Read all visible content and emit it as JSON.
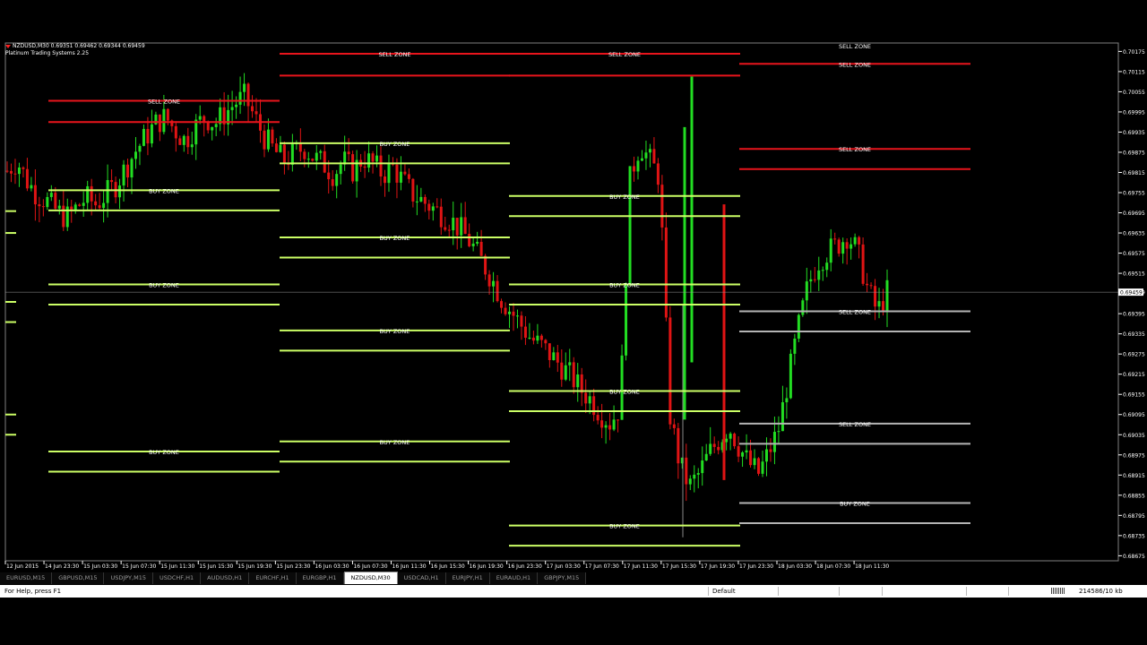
{
  "chart": {
    "symbol_line": "NZDUSD,M30  0.69351 0.69462 0.69344 0.69459",
    "indicator_name": "Platinum Trading Systems 2.25",
    "current_price": "0.69459"
  },
  "chart_data": {
    "type": "candlestick",
    "symbol": "NZDUSD",
    "timeframe": "M30",
    "ohlc": {
      "open": 0.69351,
      "high": 0.69462,
      "low": 0.69344,
      "close": 0.69459
    },
    "y_ticks": [
      "0.70175",
      "0.70115",
      "0.70055",
      "0.69995",
      "0.69935",
      "0.69875",
      "0.69815",
      "0.69755",
      "0.69695",
      "0.69635",
      "0.69575",
      "0.69515",
      "0.69459",
      "0.69395",
      "0.69335",
      "0.69275",
      "0.69215",
      "0.69155",
      "0.69095",
      "0.69035",
      "0.68975",
      "0.68915",
      "0.68855",
      "0.68795",
      "0.68735",
      "0.68675"
    ],
    "x_ticks": [
      "12 Jun 2015",
      "14 Jun 23:30",
      "15 Jun 03:30",
      "15 Jun 07:30",
      "15 Jun 11:30",
      "15 Jun 15:30",
      "15 Jun 19:30",
      "15 Jun 23:30",
      "16 Jun 03:30",
      "16 Jun 07:30",
      "16 Jun 11:30",
      "16 Jun 15:30",
      "16 Jun 19:30",
      "16 Jun 23:30",
      "17 Jun 03:30",
      "17 Jun 07:30",
      "17 Jun 11:30",
      "17 Jun 15:30",
      "17 Jun 19:30",
      "17 Jun 23:30",
      "18 Jun 03:30",
      "18 Jun 07:30",
      "18 Jun 11:30"
    ],
    "zones": [
      {
        "label": "SELL ZONE",
        "kind": "sell",
        "col": 0,
        "top": 0.70028,
        "bottom": 0.69965
      },
      {
        "label": "BUY ZONE",
        "kind": "buy",
        "col": 0,
        "top": 0.69762,
        "bottom": 0.69702
      },
      {
        "label": "BUY ZONE",
        "kind": "buy",
        "col": 0,
        "top": 0.69482,
        "bottom": 0.69422
      },
      {
        "label": "BUY ZONE",
        "kind": "buy",
        "col": 0,
        "top": 0.68985,
        "bottom": 0.68925
      },
      {
        "label": "SELL ZONE",
        "kind": "sell",
        "col": 1,
        "top": 0.70168,
        "bottom": 0.70103
      },
      {
        "label": "BUY ZONE",
        "kind": "buy",
        "col": 1,
        "top": 0.69902,
        "bottom": 0.69842
      },
      {
        "label": "BUY ZONE",
        "kind": "buy",
        "col": 1,
        "top": 0.69622,
        "bottom": 0.69562
      },
      {
        "label": "BUY ZONE",
        "kind": "buy",
        "col": 1,
        "top": 0.69345,
        "bottom": 0.69285
      },
      {
        "label": "BUY ZONE",
        "kind": "buy",
        "col": 1,
        "top": 0.69015,
        "bottom": 0.68955
      },
      {
        "label": "SELL ZONE",
        "kind": "sell",
        "col": 2,
        "top": 0.70168,
        "bottom": 0.70103
      },
      {
        "label": "BUY ZONE",
        "kind": "buy",
        "col": 2,
        "top": 0.69745,
        "bottom": 0.69685
      },
      {
        "label": "BUY ZONE",
        "kind": "buy",
        "col": 2,
        "top": 0.69482,
        "bottom": 0.69422
      },
      {
        "label": "BUY ZONE",
        "kind": "buy",
        "col": 2,
        "top": 0.69165,
        "bottom": 0.69105
      },
      {
        "label": "BUY ZONE",
        "kind": "buy",
        "col": 2,
        "top": 0.68765,
        "bottom": 0.68705
      },
      {
        "label": "SELL ZONE",
        "kind": "sell",
        "col": 3,
        "top": 0.70138,
        "bottom": 0.70138
      },
      {
        "label": "SELL ZONE",
        "kind": "sell",
        "col": 3,
        "top": 0.69885,
        "bottom": 0.69825
      },
      {
        "label": "SELL ZONE",
        "kind": "neutral",
        "col": 3,
        "top": 0.69402,
        "bottom": 0.69342
      },
      {
        "label": "SELL ZONE",
        "kind": "neutral",
        "col": 3,
        "top": 0.69068,
        "bottom": 0.69008
      },
      {
        "label": "BUY ZONE",
        "kind": "neutral",
        "col": 3,
        "top": 0.68832,
        "bottom": 0.68772
      }
    ],
    "columns": [
      "15 Jun",
      "16 Jun",
      "17 Jun",
      "18 Jun"
    ],
    "price_path": [
      0.6982,
      0.6985,
      0.6979,
      0.6975,
      0.6973,
      0.697,
      0.6968,
      0.6971,
      0.6974,
      0.6972,
      0.6975,
      0.6978,
      0.6983,
      0.6988,
      0.6992,
      0.6996,
      0.6998,
      0.6994,
      0.6991,
      0.6995,
      0.6998,
      0.6996,
      0.6999,
      0.7002,
      0.7004,
      0.6998,
      0.6992,
      0.6988,
      0.6985,
      0.6987,
      0.6989,
      0.6986,
      0.6984,
      0.6981,
      0.6985,
      0.6982,
      0.6986,
      0.6984,
      0.6981,
      0.6983,
      0.6979,
      0.6975,
      0.6973,
      0.6971,
      0.6969,
      0.6967,
      0.6964,
      0.696,
      0.6955,
      0.695,
      0.6944,
      0.694,
      0.6936,
      0.6932,
      0.693,
      0.6927,
      0.6924,
      0.6921,
      0.6917,
      0.6914,
      0.691,
      0.6907,
      0.6912,
      0.698,
      0.699,
      0.6985,
      0.698,
      0.691,
      0.6895,
      0.6888,
      0.6892,
      0.6898,
      0.6902,
      0.6906,
      0.69,
      0.6895,
      0.6892,
      0.6898,
      0.6905,
      0.692,
      0.6935,
      0.6948,
      0.6955,
      0.6958,
      0.696,
      0.6963,
      0.6958,
      0.6947,
      0.694,
      0.6946
    ]
  },
  "tabs": {
    "items": [
      "EURUSD,M15",
      "GBPUSD,M15",
      "USDJPY,M15",
      "USDCHF,H1",
      "AUDUSD,H1",
      "EURCHF,H1",
      "EURGBP,H1",
      "NZDUSD,M30",
      "USDCAD,H1",
      "EURJPY,H1",
      "EURAUD,H1",
      "GBPJPY,M15"
    ],
    "active_index": 7
  },
  "status": {
    "help": "For Help, press F1",
    "profile": "Default",
    "traffic": "214586/10 kb"
  },
  "colors": {
    "sell_zone": "#e8141c",
    "buy_zone": "#ccff66",
    "neutral_zone": "#b4b4b4",
    "bull_candle": "#22dd22",
    "bear_candle": "#e01414",
    "axis": "#ffffff",
    "background": "#000000"
  }
}
